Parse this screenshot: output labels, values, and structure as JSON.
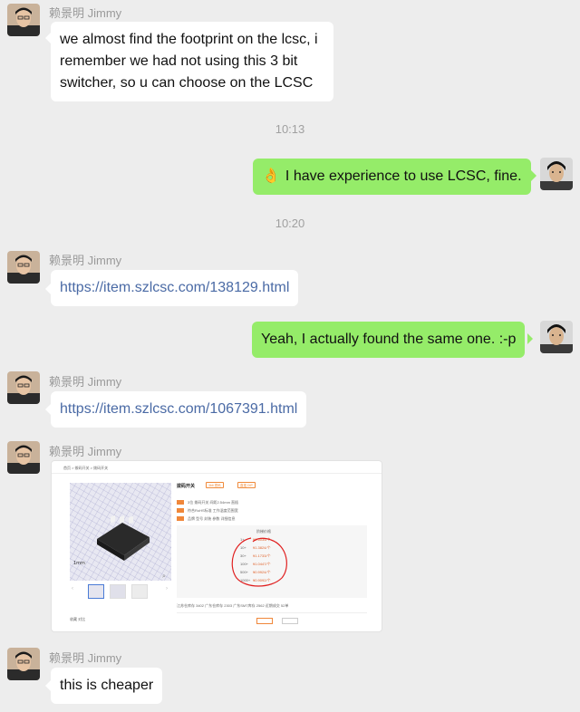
{
  "colors": {
    "background": "#ededed",
    "incoming_bubble": "#ffffff",
    "outgoing_bubble": "#95ec69",
    "link": "#4a6aa5",
    "meta_text": "#9a9a9a"
  },
  "messages": [
    {
      "sender": "赖景明 Jimmy",
      "text_lines": [
        "we almost find the footprint on the lcsc, i",
        "remember we had not using this 3 bit",
        "switcher, so u can choose on the LCSC"
      ]
    },
    {
      "time": "10:13"
    },
    {
      "emoji": "👌",
      "text": "I have experience to use LCSC, fine."
    },
    {
      "time": "10:20"
    },
    {
      "sender": "赖景明 Jimmy",
      "link": "https://item.szlcsc.com/138129.html"
    },
    {
      "text": "Yeah, I actually found the same one. :-p"
    },
    {
      "sender": "赖景明 Jimmy",
      "link": "https://item.szlcsc.com/1067391.html"
    },
    {
      "sender": "赖景明 Jimmy",
      "image": {
        "breadcrumb": "首页 > 拨码开关 > 拨码开关",
        "product_title": "拨码开关",
        "tag_1": "3bit 拨码",
        "tag_2": "直插 DIP",
        "spec_lines": [
          "3位 拨码开关 间距2.54mm 直插",
          "符合RoHS标准 工作温度范围宽",
          "品牌 型号 封装 参数 详细信息"
        ],
        "price_header": "阶梯价格",
        "price_tiers": [
          {
            "qty": "1+",
            "price": "¥1.6035/个"
          },
          {
            "qty": "10+",
            "price": "¥1.3824/个"
          },
          {
            "qty": "30+",
            "price": "¥1.1733/个"
          },
          {
            "qty": "100+",
            "price": "¥1.0447/个"
          },
          {
            "qty": "500+",
            "price": "¥0.9924/个"
          },
          {
            "qty": "1000+",
            "price": "¥0.9092/个"
          }
        ],
        "stock_line": "江苏仓库存 3402  广东仓库存 2303  广东SMT库存 2562  近期成交 52单",
        "action_line": "收藏  对比"
      }
    },
    {
      "sender": "赖景明 Jimmy",
      "text": "this is cheaper"
    }
  ]
}
